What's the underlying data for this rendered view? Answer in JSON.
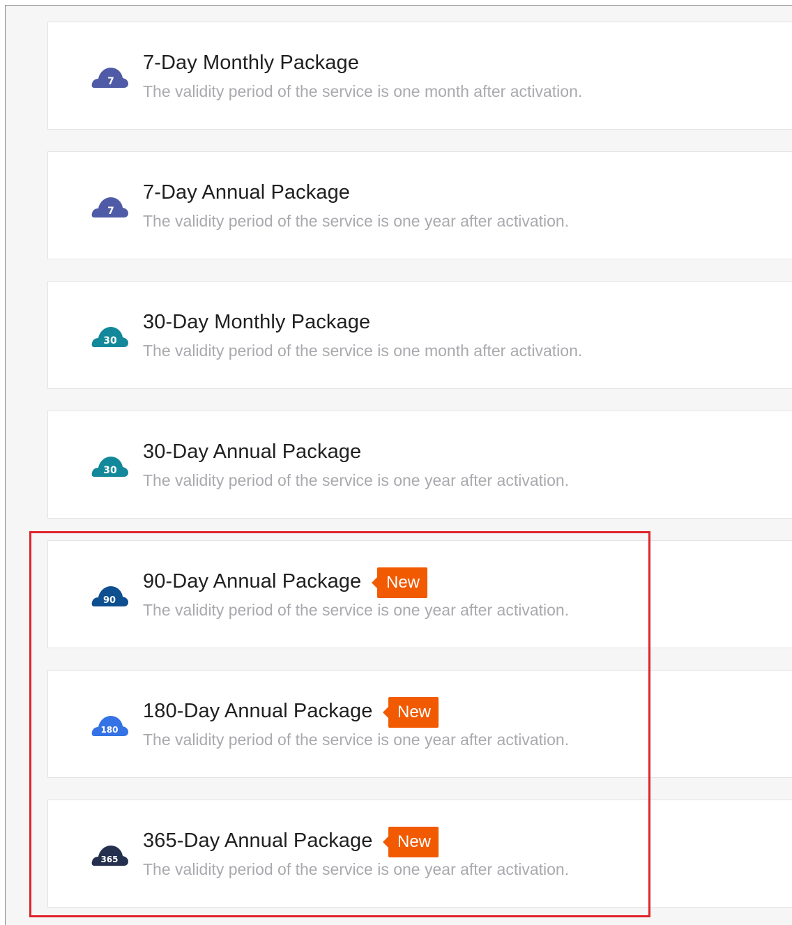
{
  "colors": {
    "accent_new_badge": "#f15a00",
    "highlight_border": "#e0232a",
    "title_text": "#1f1f1f",
    "description_text": "#a9a9ae",
    "background": "#f6f6f7"
  },
  "packages": [
    {
      "title": "7-Day Monthly Package",
      "description": "The validity period of the service is one month after activation.",
      "icon": {
        "name": "cloud-icon",
        "label": "7",
        "color": "#4f5ba6"
      },
      "badge": null
    },
    {
      "title": "7-Day Annual Package",
      "description": "The validity period of the service is one year after activation.",
      "icon": {
        "name": "cloud-icon",
        "label": "7",
        "color": "#4f5ba6"
      },
      "badge": null
    },
    {
      "title": "30-Day Monthly Package",
      "description": "The validity period of the service is one month after activation.",
      "icon": {
        "name": "cloud-icon",
        "label": "30",
        "color": "#12889a"
      },
      "badge": null
    },
    {
      "title": "30-Day Annual Package",
      "description": "The validity period of the service is one year after activation.",
      "icon": {
        "name": "cloud-icon",
        "label": "30",
        "color": "#12889a"
      },
      "badge": null
    },
    {
      "title": "90-Day Annual Package",
      "description": "The validity period of the service is one year after activation.",
      "icon": {
        "name": "cloud-icon",
        "label": "90",
        "color": "#0d4f8f"
      },
      "badge": "New"
    },
    {
      "title": "180-Day Annual Package",
      "description": "The validity period of the service is one year after activation.",
      "icon": {
        "name": "cloud-icon",
        "label": "180",
        "color": "#3472e6"
      },
      "badge": "New"
    },
    {
      "title": "365-Day Annual Package",
      "description": "The validity period of the service is one year after activation.",
      "icon": {
        "name": "cloud-icon",
        "label": "365",
        "color": "#25304f"
      },
      "badge": "New"
    }
  ]
}
